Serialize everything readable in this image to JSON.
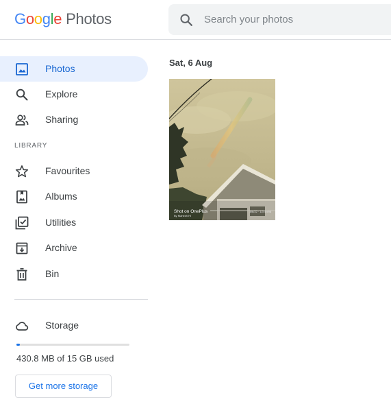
{
  "app": {
    "logo_letters": [
      "G",
      "o",
      "o",
      "g",
      "l",
      "e"
    ],
    "product_name": "Photos"
  },
  "search": {
    "placeholder": "Search your photos"
  },
  "sidebar": {
    "items": [
      {
        "label": "Photos",
        "icon": "photo-icon",
        "active": true
      },
      {
        "label": "Explore",
        "icon": "search-icon",
        "active": false
      },
      {
        "label": "Sharing",
        "icon": "people-icon",
        "active": false
      }
    ],
    "library_label": "LIBRARY",
    "library_items": [
      {
        "label": "Favourites",
        "icon": "star-icon"
      },
      {
        "label": "Albums",
        "icon": "album-icon"
      },
      {
        "label": "Utilities",
        "icon": "utilities-icon"
      },
      {
        "label": "Archive",
        "icon": "archive-icon"
      },
      {
        "label": "Bin",
        "icon": "trash-icon"
      }
    ],
    "storage": {
      "label": "Storage",
      "icon": "cloud-icon",
      "used_text": "430.8 MB of 15 GB used",
      "used_fraction": 0.028,
      "button_label": "Get more storage"
    }
  },
  "main": {
    "groups": [
      {
        "date": "Sat, 6 Aug",
        "photos": [
          {
            "watermark": "Shot on OnePlus",
            "watermark_sub": "By Mahesh Hi",
            "watermark_meta": "8/6/22 · 1/3 4 f/98"
          }
        ]
      }
    ]
  },
  "colors": {
    "accent": "#1a73e8",
    "active_bg": "#e8f0fe",
    "active_text": "#1967d2",
    "text": "#3c4043",
    "muted": "#5f6368"
  }
}
